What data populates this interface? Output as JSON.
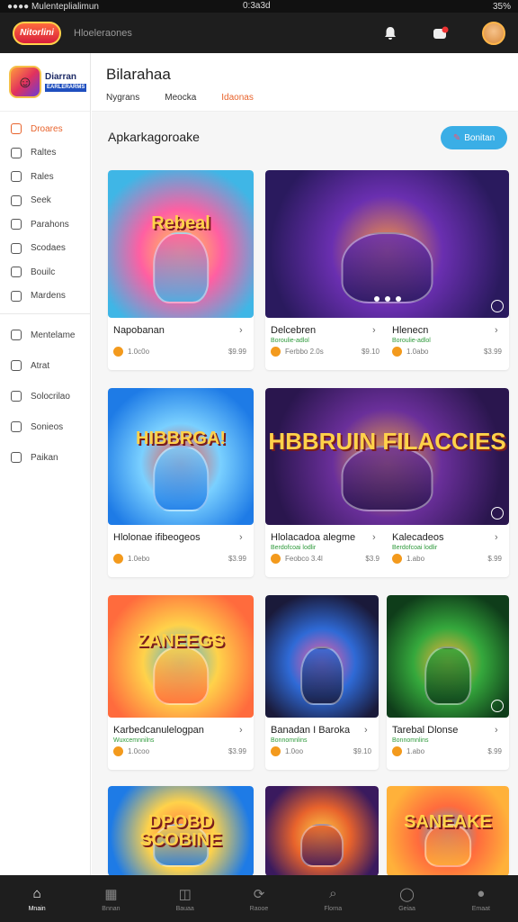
{
  "status": {
    "left": "●●●● Mulenteplialimun",
    "time": "0:3a3d",
    "battery": "35%"
  },
  "topbar": {
    "brand": "Nitorlini",
    "subtitle": "Hloeleraones"
  },
  "sidebar": {
    "app_name": "Diarran",
    "app_tag": "EARLERARMS",
    "items": [
      {
        "label": "Droares",
        "active": true
      },
      {
        "label": "Raltes"
      },
      {
        "label": "Rales"
      },
      {
        "label": "Seek"
      },
      {
        "label": "Parahons"
      },
      {
        "label": "Scodaes"
      },
      {
        "label": "Bouilc"
      },
      {
        "label": "Mardens"
      }
    ],
    "items2": [
      {
        "label": "Mentelame"
      },
      {
        "label": "Atrat"
      },
      {
        "label": "Solocrilao"
      },
      {
        "label": "Sonieos"
      },
      {
        "label": "Paikan"
      }
    ]
  },
  "main": {
    "title": "Bilarahaa",
    "tabs": [
      {
        "label": "Nygrans"
      },
      {
        "label": "Meocka"
      },
      {
        "label": "Idaonas",
        "active": true
      }
    ],
    "section_title": "Apkarkagoroake",
    "section_button": "Bonitan"
  },
  "cards": [
    {
      "title": "Napobanan",
      "sub": "",
      "meta_left": "1.0c0o",
      "meta_right": "$9.99",
      "art": "Rebeal",
      "colors": [
        "#3fb6e6",
        "#ff5fa2",
        "#ffd24a"
      ]
    },
    {
      "title": "Delcebren",
      "sub": "Boroulie-adlol",
      "meta_left": "Ferbbo 2.0s",
      "meta_right": "$9.10",
      "art": "",
      "colors": [
        "#2a1a5e",
        "#6a2fb0",
        "#ff9a3c"
      ]
    },
    {
      "title": "Hlenecn",
      "sub": "Boroulie-adlol",
      "meta_left": "1.0abo",
      "meta_right": "$3.99",
      "art": "",
      "colors": [
        "#2a1a5e",
        "#6a2fb0",
        "#ff9a3c"
      ]
    },
    {
      "title": "Hlolonae ifibeogeos",
      "sub": "",
      "meta_left": "1.0ebo",
      "meta_right": "$3.99",
      "art": "HIBBRGA!",
      "colors": [
        "#1e7be6",
        "#7ad0ff",
        "#ff4f3a"
      ]
    },
    {
      "title": "Hlolacadoa alegme",
      "sub": "Berdofcoai lodlir",
      "meta_left": "Feobco 3.4l",
      "meta_right": "$3.9",
      "art": "HBBRUIN FILACCIES",
      "colors": [
        "#2a164e",
        "#6a2f9a",
        "#ffb13a"
      ]
    },
    {
      "title": "Kalecadeos",
      "sub": "Berdofcoai lodlir",
      "meta_left": "1.abo",
      "meta_right": "$.99",
      "art": "",
      "colors": [
        "#2a164e",
        "#6a2f9a",
        "#ffb13a"
      ]
    },
    {
      "title": "Karbedcanulelogpan",
      "sub": "Wuxcemnnilns",
      "meta_left": "1.0coo",
      "meta_right": "$3.99",
      "art": "ZANEEGS",
      "colors": [
        "#ff6b3d",
        "#ffd24a",
        "#3aaee6"
      ]
    },
    {
      "title": "Banadan I Baroka",
      "sub": "Bonnomnlins",
      "meta_left": "1.0oo",
      "meta_right": "$9.10",
      "art": "",
      "colors": [
        "#1a1a3a",
        "#2f6ad6",
        "#ff5fa2"
      ]
    },
    {
      "title": "Tarebal Dlonse",
      "sub": "Bonnomnlins",
      "meta_left": "1.abo",
      "meta_right": "$.99",
      "art": "",
      "colors": [
        "#0f3d1a",
        "#35a83c",
        "#ffb13a"
      ]
    },
    {
      "title": "",
      "sub": "",
      "meta_left": "",
      "meta_right": "",
      "art": "DPOBD SCOBINE",
      "colors": [
        "#1e7be6",
        "#ffd24a",
        "#ff6b3d"
      ]
    },
    {
      "title": "",
      "sub": "",
      "meta_left": "",
      "meta_right": "",
      "art": "",
      "colors": [
        "#3a1a5e",
        "#e8632c",
        "#ffd24a"
      ]
    },
    {
      "title": "",
      "sub": "",
      "meta_left": "",
      "meta_right": "",
      "art": "SANEAKE",
      "colors": [
        "#ffb13a",
        "#ff6b3d",
        "#3aaee6"
      ]
    }
  ],
  "bottom_nav": [
    {
      "label": "Mnain",
      "icon": "home-icon",
      "active": true
    },
    {
      "label": "Bnnan",
      "icon": "store-icon"
    },
    {
      "label": "Bauaa",
      "icon": "bag-icon"
    },
    {
      "label": "Raooe",
      "icon": "refresh-icon"
    },
    {
      "label": "Florna",
      "icon": "search-icon"
    },
    {
      "label": "Geiaa",
      "icon": "pin-icon"
    },
    {
      "label": "Emaat",
      "icon": "profile-icon"
    }
  ]
}
